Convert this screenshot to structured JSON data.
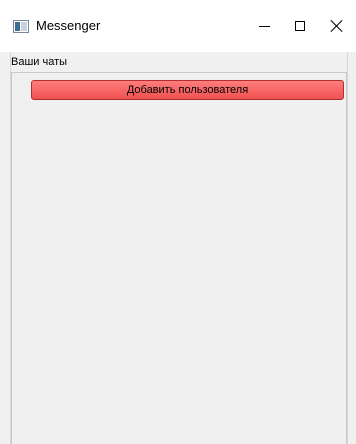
{
  "window": {
    "title": "Messenger",
    "app_icon": "window-app-icon",
    "controls": {
      "minimize_icon": "minimize-icon",
      "maximize_icon": "maximize-icon",
      "close_icon": "close-icon"
    }
  },
  "main": {
    "chats_group_label": "Ваши чаты",
    "add_user_button_label": "Добавить пользователя",
    "add_user_button_color": "#f86060"
  }
}
